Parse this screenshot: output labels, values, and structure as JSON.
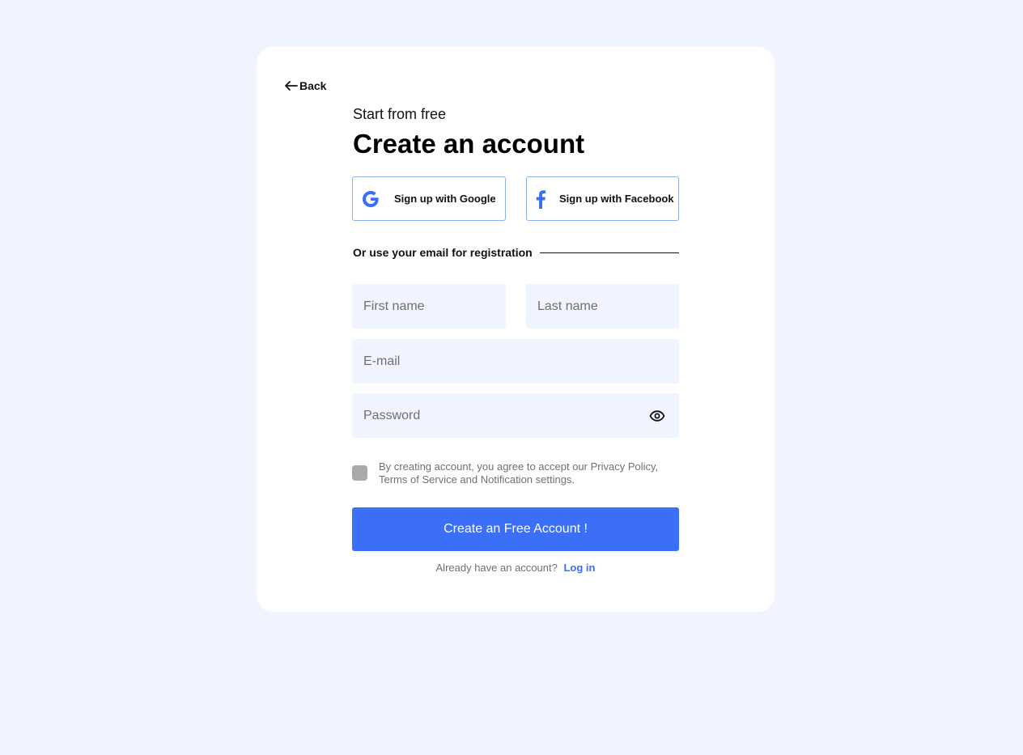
{
  "nav": {
    "back_label": "Back"
  },
  "header": {
    "subtitle": "Start from free",
    "title": "Create an account"
  },
  "social": {
    "google_label": "Sign up with Google",
    "facebook_label": "Sign up with Facebook"
  },
  "divider": {
    "text": "Or use your email for registration"
  },
  "form": {
    "first_name_placeholder": "First name",
    "last_name_placeholder": "Last name",
    "email_placeholder": "E-mail",
    "password_placeholder": "Password",
    "terms_text": "By creating account, you agree to accept our Privacy Policy, Terms of Service and Notification settings.",
    "submit_label": "Create an Free Account !"
  },
  "footer": {
    "prompt": "Already have an account?",
    "login_label": "Log in"
  },
  "colors": {
    "background": "#eff4fe",
    "accent": "#3b6ff7",
    "card": "#ffffff"
  },
  "icons": [
    "arrow-left-icon",
    "google-icon",
    "facebook-icon",
    "eye-icon"
  ]
}
